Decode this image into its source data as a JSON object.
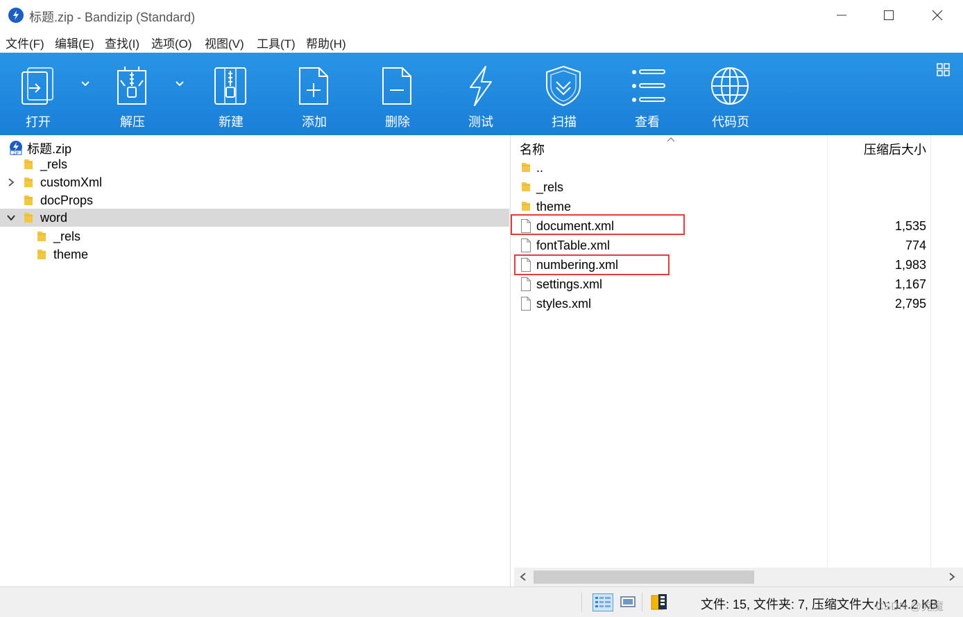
{
  "window": {
    "title": "标题.zip - Bandizip (Standard)",
    "icon": "bandizip-logo-icon"
  },
  "menu": [
    "文件(F)",
    "编辑(E)",
    "查找(I)",
    "选项(O)",
    "视图(V)",
    "工具(T)",
    "帮助(H)"
  ],
  "toolbar": {
    "open": "打开",
    "extract": "解压",
    "new": "新建",
    "add": "添加",
    "delete": "删除",
    "test": "测试",
    "scan": "扫描",
    "view": "查看",
    "codepage": "代码页"
  },
  "tree": {
    "root": "标题.zip",
    "items": [
      {
        "label": "_rels",
        "level": 1,
        "expandable": false,
        "selected": false
      },
      {
        "label": "customXml",
        "level": 1,
        "expandable": true,
        "selected": false
      },
      {
        "label": "docProps",
        "level": 1,
        "expandable": false,
        "selected": false
      },
      {
        "label": "word",
        "level": 1,
        "expandable": true,
        "expanded": true,
        "selected": true
      },
      {
        "label": "_rels",
        "level": 2,
        "expandable": false,
        "selected": false
      },
      {
        "label": "theme",
        "level": 2,
        "expandable": false,
        "selected": false
      }
    ]
  },
  "list": {
    "columns": {
      "name": "名称",
      "size": "压缩后大小"
    },
    "rows": [
      {
        "type": "folder",
        "name": "..",
        "size": ""
      },
      {
        "type": "folder",
        "name": "_rels",
        "size": ""
      },
      {
        "type": "folder",
        "name": "theme",
        "size": ""
      },
      {
        "type": "file",
        "name": "document.xml",
        "size": "1,535",
        "highlighted": true
      },
      {
        "type": "file",
        "name": "fontTable.xml",
        "size": "774"
      },
      {
        "type": "file",
        "name": "numbering.xml",
        "size": "1,983",
        "highlighted": true
      },
      {
        "type": "file",
        "name": "settings.xml",
        "size": "1,167"
      },
      {
        "type": "file",
        "name": "styles.xml",
        "size": "2,795"
      }
    ]
  },
  "status": {
    "text": "文件: 15, 文件夹: 7, 压缩文件大小: 14.2 KB",
    "watermark": "CSDN @克魔"
  },
  "colors": {
    "toolbar": "#1f86dc",
    "folder": "#f2c744",
    "highlight": "#e23c3c",
    "selection": "#d9d9d9"
  }
}
